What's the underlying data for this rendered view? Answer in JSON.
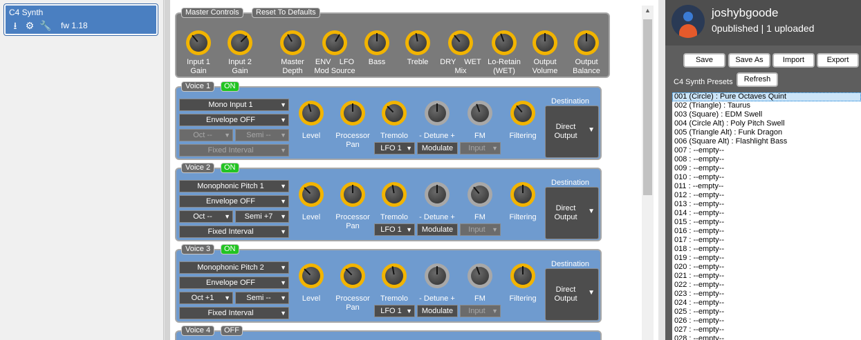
{
  "device": {
    "name": "C4 Synth",
    "firmware": "fw 1.18",
    "icons": [
      "download-icon",
      "gear-icon",
      "wrench-icon"
    ]
  },
  "master": {
    "tab_label": "Master Controls",
    "reset_label": "Reset To Defaults",
    "knobs": [
      {
        "label": "Input 1\nGain",
        "angle": -40
      },
      {
        "label": "Input 2\nGain",
        "angle": 45
      },
      {
        "label": "Master\nDepth",
        "angle": -30
      },
      {
        "label": "ENV    LFO\nMod Source",
        "angle": 30
      },
      {
        "label": "Bass",
        "angle": 0
      },
      {
        "label": "Treble",
        "angle": -10
      },
      {
        "label": "DRY    WET\nMix",
        "angle": -40
      },
      {
        "label": "Lo-Retain\n(WET)",
        "angle": -20
      },
      {
        "label": "Output\nVolume",
        "angle": 0
      },
      {
        "label": "Output\nBalance",
        "angle": 0
      }
    ]
  },
  "voices": [
    {
      "label": "Voice 1",
      "state": "ON",
      "input": "Mono Input 1",
      "envelope": "Envelope OFF",
      "oct": "Oct --",
      "semi": "Semi --",
      "interval": "Fixed Interval",
      "oct_disabled": true,
      "semi_disabled": true,
      "interval_disabled": true,
      "knobs": [
        {
          "label": "Level",
          "angle": -15
        },
        {
          "label": "Processor\nPan",
          "angle": 0
        },
        {
          "label": "Tremolo",
          "angle": -45
        },
        {
          "label": "- Detune +",
          "angle": 0
        },
        {
          "label": "FM",
          "angle": -20
        },
        {
          "label": "Filtering",
          "angle": -40
        }
      ],
      "lfo": "LFO 1",
      "modulate": "Modulate",
      "fm_input": "Input",
      "input_disabled": true,
      "dest_header": "Destination",
      "destination": "Direct\nOutput"
    },
    {
      "label": "Voice 2",
      "state": "ON",
      "input": "Monophonic Pitch 1",
      "envelope": "Envelope OFF",
      "oct": "Oct --",
      "semi": "Semi +7",
      "interval": "Fixed Interval",
      "oct_disabled": false,
      "semi_disabled": false,
      "interval_disabled": false,
      "knobs": [
        {
          "label": "Level",
          "angle": -45
        },
        {
          "label": "Processor\nPan",
          "angle": 0
        },
        {
          "label": "Tremolo",
          "angle": -10
        },
        {
          "label": "- Detune +",
          "angle": 0
        },
        {
          "label": "FM",
          "angle": -40
        },
        {
          "label": "Filtering",
          "angle": 0
        }
      ],
      "lfo": "LFO 1",
      "modulate": "Modulate",
      "fm_input": "Input",
      "input_disabled": true,
      "dest_header": "Destination",
      "destination": "Direct\nOutput"
    },
    {
      "label": "Voice 3",
      "state": "ON",
      "input": "Monophonic Pitch 2",
      "envelope": "Envelope OFF",
      "oct": "Oct +1",
      "semi": "Semi --",
      "interval": "Fixed Interval",
      "oct_disabled": false,
      "semi_disabled": false,
      "interval_disabled": false,
      "knobs": [
        {
          "label": "Level",
          "angle": -45
        },
        {
          "label": "Processor\nPan",
          "angle": -45
        },
        {
          "label": "Tremolo",
          "angle": -10
        },
        {
          "label": "- Detune +",
          "angle": 0
        },
        {
          "label": "FM",
          "angle": -20
        },
        {
          "label": "Filtering",
          "angle": 0
        }
      ],
      "lfo": "LFO 1",
      "modulate": "Modulate",
      "fm_input": "Input",
      "input_disabled": true,
      "dest_header": "Destination",
      "destination": "Direct\nOutput"
    }
  ],
  "voice4": {
    "label": "Voice 4",
    "state": "OFF"
  },
  "user": {
    "name": "joshybgoode",
    "published_count": "0",
    "published_label": "published |",
    "uploaded_count": "1",
    "uploaded_label": "uploaded"
  },
  "preset_buttons": {
    "save": "Save",
    "save_as": "Save As",
    "import": "Import",
    "export": "Export",
    "refresh": "Refresh"
  },
  "presets_label": "C4 Synth Presets",
  "presets": [
    "001 (Circle) : Pure Octaves Quint",
    "002 (Triangle) : Taurus",
    "003 (Square) : EDM Swell",
    "004 (Circle Alt) : Poly Pitch Swell",
    "005 (Triangle Alt) : Funk Dragon",
    "006 (Square Alt) : Flashlight Bass",
    "007 : --empty--",
    "008 : --empty--",
    "009 : --empty--",
    "010 : --empty--",
    "011 : --empty--",
    "012 : --empty--",
    "013 : --empty--",
    "014 : --empty--",
    "015 : --empty--",
    "016 : --empty--",
    "017 : --empty--",
    "018 : --empty--",
    "019 : --empty--",
    "020 : --empty--",
    "021 : --empty--",
    "022 : --empty--",
    "023 : --empty--",
    "024 : --empty--",
    "025 : --empty--",
    "026 : --empty--",
    "027 : --empty--",
    "028 : --empty--"
  ],
  "selected_preset": 0,
  "colors": {
    "knob_active": "#f2b400",
    "knob_inactive": "#a8a8a8",
    "on": "#22c422",
    "voice_panel": "#6f9bcf",
    "master_panel": "#7a7a7a",
    "device_selected": "#4a7fc1"
  }
}
